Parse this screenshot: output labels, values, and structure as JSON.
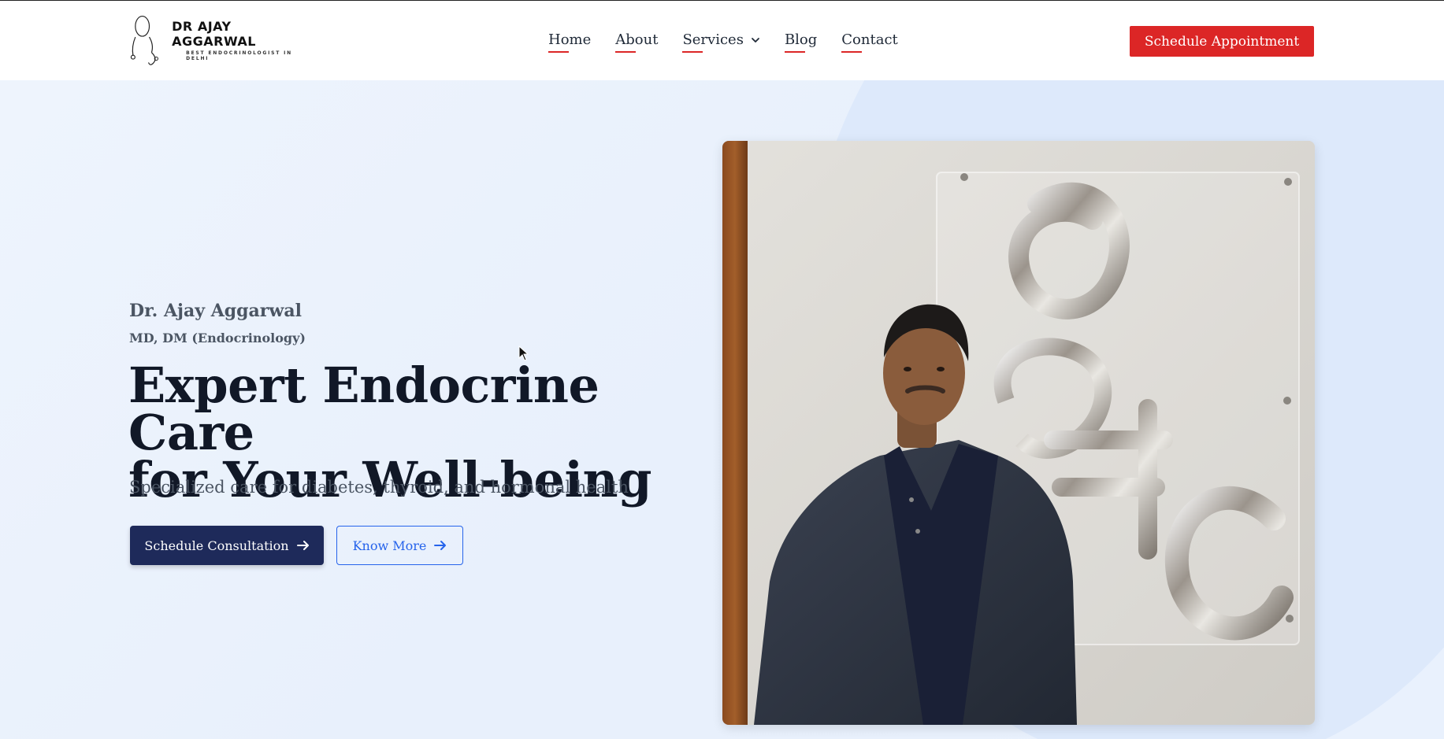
{
  "header": {
    "logo": {
      "name": "DR AJAY AGGARWAL",
      "tagline": "BEST ENDOCRINOLOGIST IN DELHI"
    },
    "nav": [
      {
        "label": "Home"
      },
      {
        "label": "About"
      },
      {
        "label": "Services",
        "has_dropdown": true
      },
      {
        "label": "Blog"
      },
      {
        "label": "Contact"
      }
    ],
    "cta_label": "Schedule Appointment"
  },
  "hero": {
    "doctor_name": "Dr. Ajay Aggarwal",
    "credentials": "MD, DM (Endocrinology)",
    "title_line1": "Expert Endocrine Care",
    "title_line2": "for Your Well-being",
    "description": "Specialized care for diabetes, thyroid, and hormonal health",
    "primary_button": "Schedule Consultation",
    "secondary_button": "Know More",
    "photo_sign_letters": "DHC"
  },
  "colors": {
    "accent_red": "#dc2626",
    "navy": "#1e2a5a",
    "link_blue": "#2563eb",
    "hero_bg": "#eaf2fd"
  }
}
